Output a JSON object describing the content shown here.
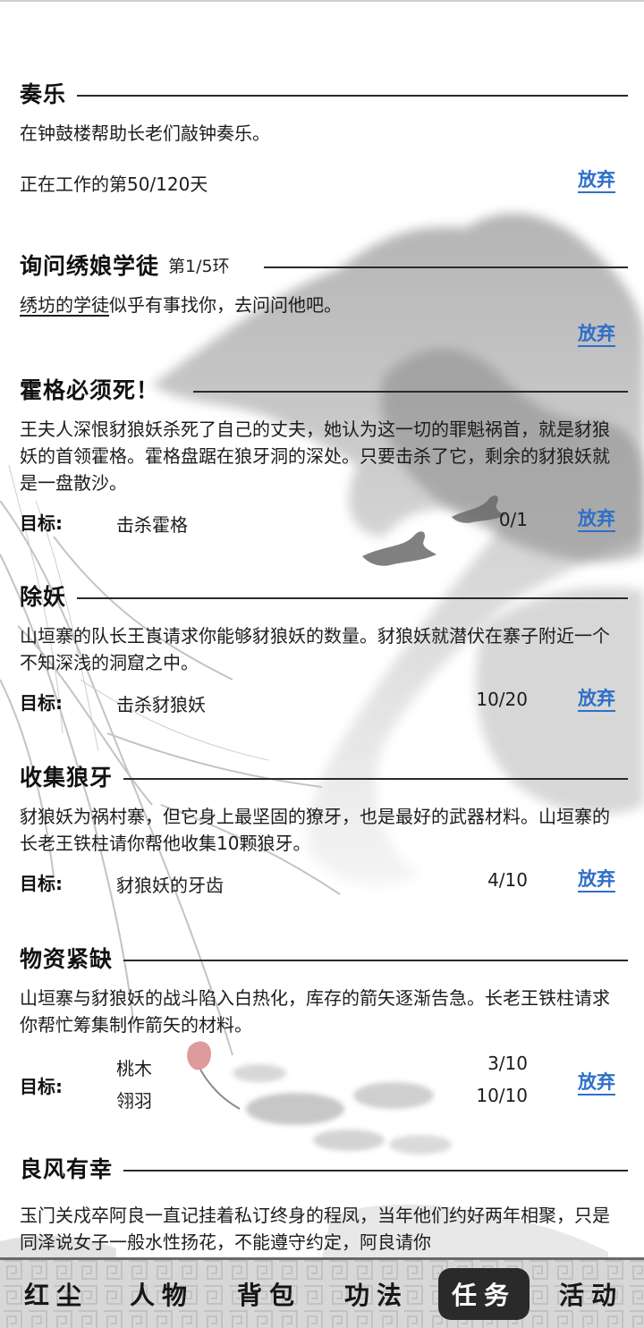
{
  "quests": [
    {
      "title": "奏乐",
      "round": "",
      "description": "在钟鼓楼帮助长老们敲钟奏乐。",
      "progress_text": "正在工作的第50/120天",
      "abandon_label": "放弃"
    },
    {
      "title": "询问绣娘学徒",
      "round": "第1/5环",
      "description_link": "绣坊的学徒",
      "description_rest": "似乎有事找你，去问问他吧。",
      "abandon_label": "放弃"
    },
    {
      "title": "霍格必须死！",
      "description": "王夫人深恨豺狼妖杀死了自己的丈夫，她认为这一切的罪魁祸首，就是豺狼妖的首领霍格。霍格盘踞在狼牙洞的深处。只要击杀了它，剩余的豺狼妖就是一盘散沙。",
      "target_label": "目标:",
      "targets": [
        {
          "name": "击杀霍格",
          "count": "0/1"
        }
      ],
      "abandon_label": "放弃"
    },
    {
      "title": "除妖",
      "description": "山垣寨的队长王崀请求你能够豺狼妖的数量。豺狼妖就潜伏在寨子附近一个不知深浅的洞窟之中。",
      "target_label": "目标:",
      "targets": [
        {
          "name": "击杀豺狼妖",
          "count": "10/20"
        }
      ],
      "abandon_label": "放弃"
    },
    {
      "title": "收集狼牙",
      "description": "豺狼妖为祸村寨，但它身上最坚固的獠牙，也是最好的武器材料。山垣寨的长老王铁柱请你帮他收集10颗狼牙。",
      "target_label": "目标:",
      "targets": [
        {
          "name": "豺狼妖的牙齿",
          "count": "4/10"
        }
      ],
      "abandon_label": "放弃"
    },
    {
      "title": "物资紧缺",
      "description": "山垣寨与豺狼妖的战斗陷入白热化，库存的箭矢逐渐告急。长老王铁柱请求你帮忙筹集制作箭矢的材料。",
      "target_label": "目标:",
      "targets": [
        {
          "name": "桃木",
          "count": "3/10"
        },
        {
          "name": "翎羽",
          "count": "10/10"
        }
      ],
      "abandon_label": "放弃"
    },
    {
      "title": "良风有幸",
      "description": "玉门关戍卒阿良一直记挂着私订终身的程凤，当年他们约好两年相聚，只是同泽说女子一般水性扬花，不能遵守约定，阿良请你"
    }
  ],
  "nav": [
    {
      "label": "红尘",
      "active": false
    },
    {
      "label": "人物",
      "active": false
    },
    {
      "label": "背包",
      "active": false
    },
    {
      "label": "功法",
      "active": false
    },
    {
      "label": "任务",
      "active": true
    },
    {
      "label": "活动",
      "active": false
    }
  ],
  "colors": {
    "abandon": "#2f6fc9",
    "nav_bg": "#d4d4d4",
    "nav_active": "#2a2a2a"
  },
  "background": "ink-wash-landscape"
}
